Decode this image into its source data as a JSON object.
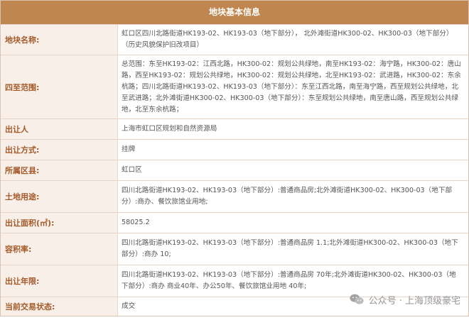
{
  "table": {
    "title": "地块基本信息",
    "rows": [
      {
        "label": "地块名称:",
        "value": "虹口区四川北路街道HK193-02、HK193-03（地下部分）， 北外滩街道HK300-02、HK300-03（地下部分）（历史风貌保护旧改项目）"
      },
      {
        "label": "四至范围:",
        "value": "总范围：东至HK193-02：江西北路，HK300-02：规划公共绿地，南至HK193-02：海宁路，HK300-02：唐山路，西至HK193-02：规划公共绿地，HK300-02：规划公共绿地，北至HK193-02：武进路，HK300-02：东余杭路；四川北路街道HK193-02、HK193-03（地下部分）：东至江西北路，南至海宁路，西至规划公共绿地，北至武进路；北外滩街道HK300-02、HK300-03（地下部分）：东至规划公共绿地，南至唐山路，西至规划公共绿地，北至东余杭路；"
      },
      {
        "label": "出让人",
        "value": "上海市虹口区规划和自然资源局"
      },
      {
        "label": "出让方式:",
        "value": "挂牌"
      },
      {
        "label": "所属区县:",
        "value": "虹口区"
      },
      {
        "label": "土地用途:",
        "value": "四川北路街道HK193-02、HK193-03（地下部分）:普通商品房;北外滩街道HK300-02、HK300-03（地下部分）:商办、餐饮旅馆业用地;"
      },
      {
        "label": "出让面积(㎡):",
        "value": "58025.2"
      },
      {
        "label": "容积率:",
        "value": "四川北路街道HK193-02、HK193-03（地下部分）:普通商品房 1.1;北外滩街道HK300-02、HK300-03（地下部分）:商办 10;"
      },
      {
        "label": "出让年限:",
        "value": "四川北路街道HK193-02、HK193-03（地下部分）:普通商品房 70年;北外滩街道HK300-02、HK300-03（地下部分）:商办 商业40年、办公50年、餐饮旅馆业用地 40年;"
      },
      {
        "label": "当前交易状态:",
        "value": "成交"
      }
    ]
  },
  "watermark": {
    "text": "公众号 · 上海顶级豪宅",
    "icon": "wechat-icon"
  }
}
